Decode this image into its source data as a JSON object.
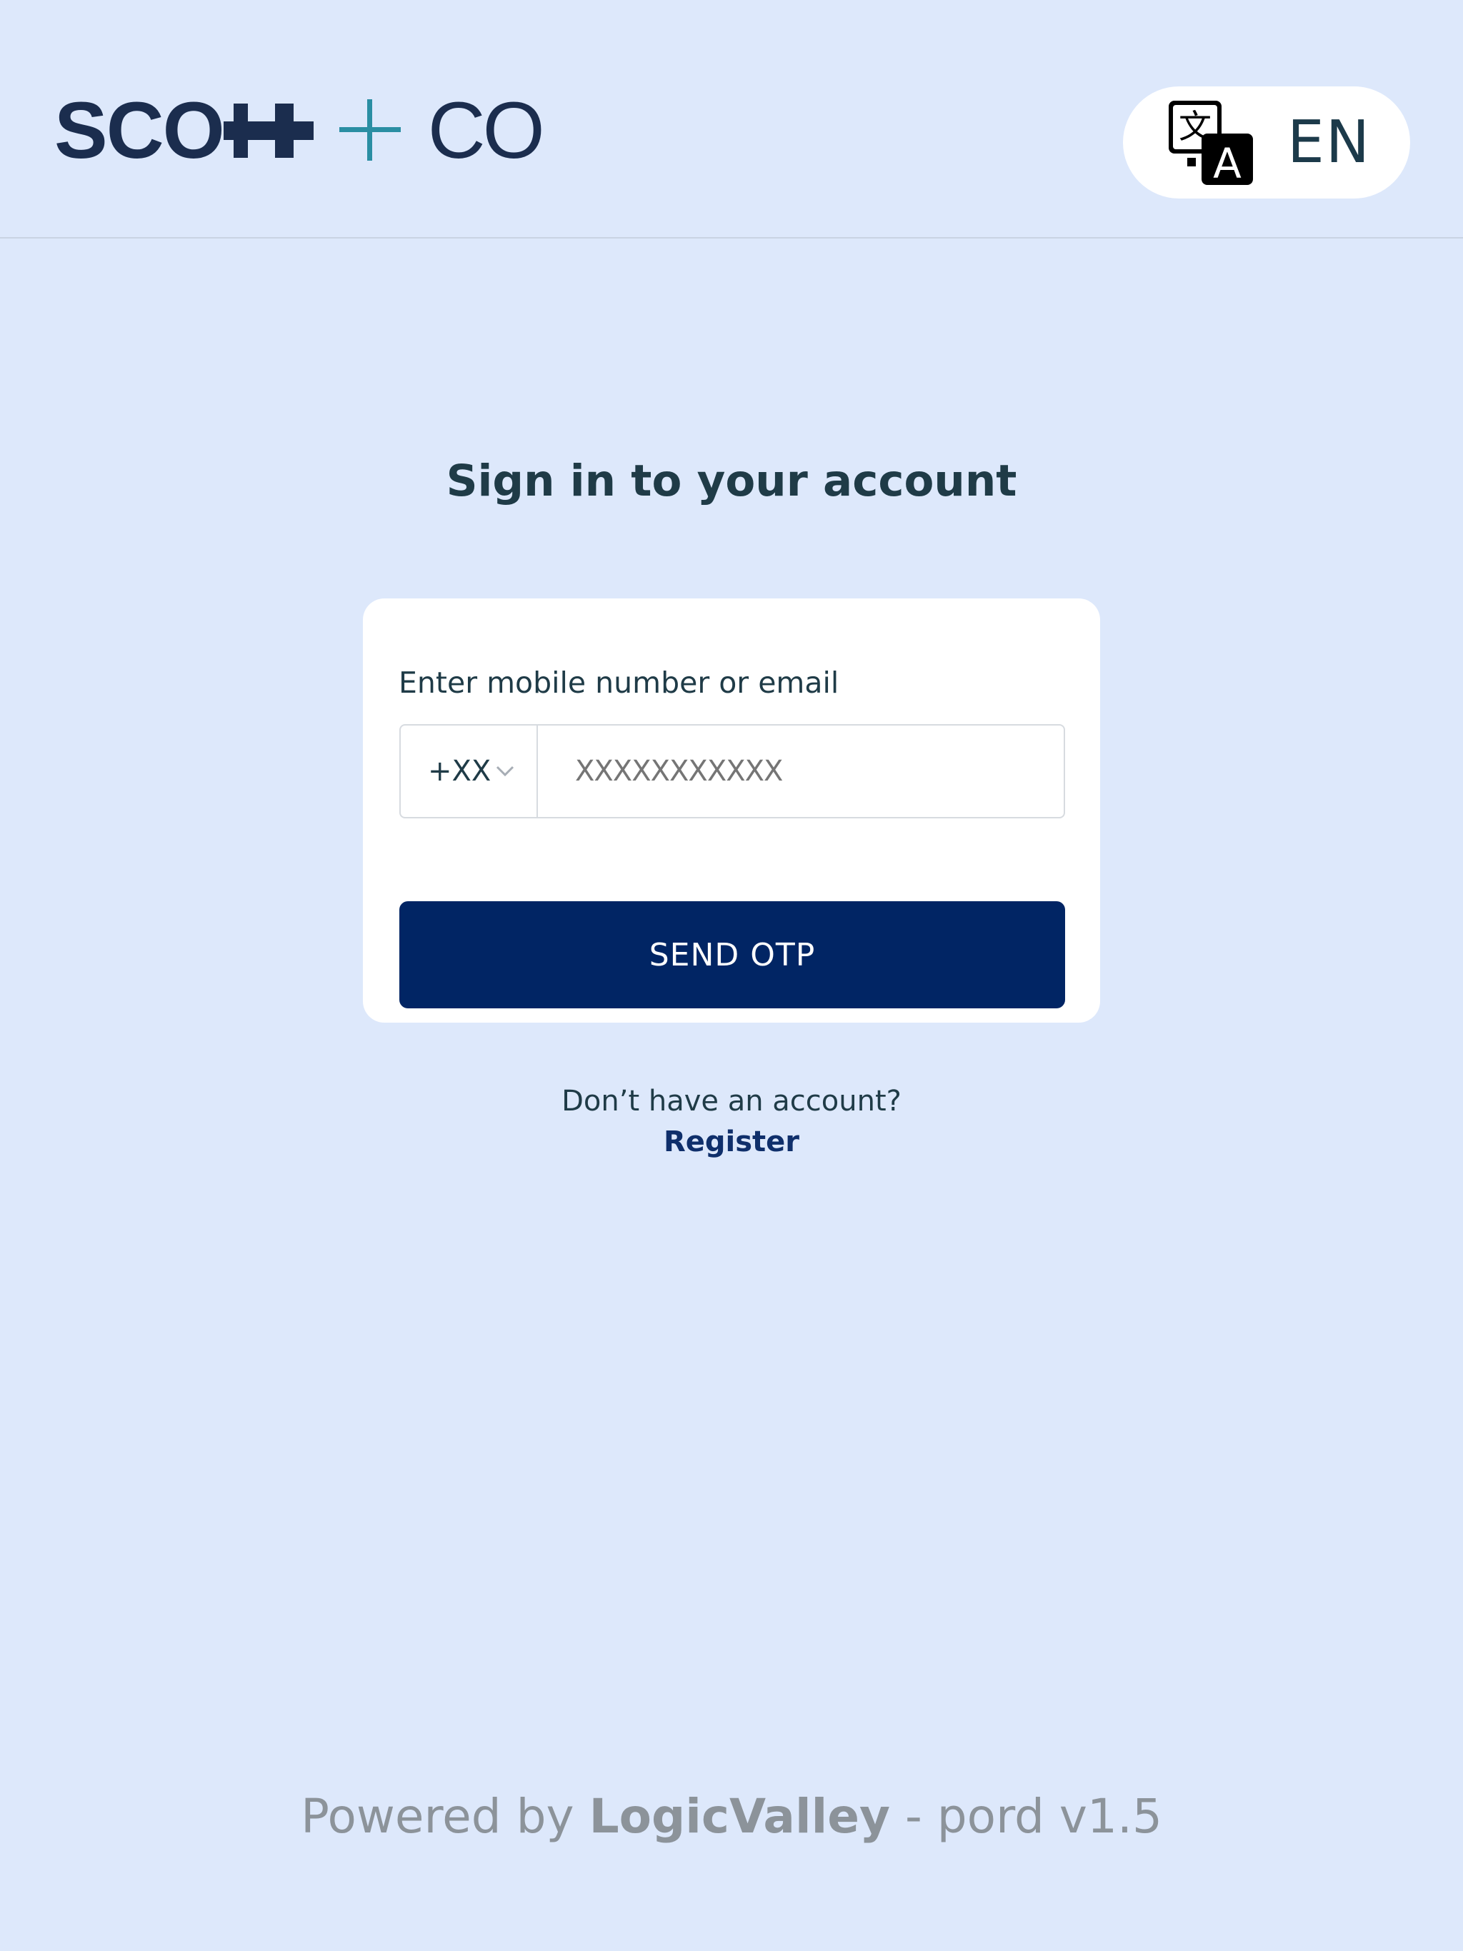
{
  "header": {
    "logo": {
      "word": "SCO",
      "co": "CO"
    },
    "language": {
      "label": "EN"
    }
  },
  "main": {
    "title": "Sign in to your account",
    "form": {
      "field_label": "Enter mobile number or email",
      "country_code": "+XX",
      "phone_placeholder": "XXXXXXXXXXX",
      "submit_label": "SEND OTP"
    },
    "register": {
      "question": "Don’t have an account?",
      "link_label": "Register"
    }
  },
  "footer": {
    "prefix": "Powered by ",
    "brand": "LogicValley",
    "suffix": " - pord v1.5"
  },
  "colors": {
    "background": "#dde8fb",
    "primary_button": "#012564",
    "logo_navy": "#1b2d4e",
    "logo_teal": "#2a8ea3"
  }
}
